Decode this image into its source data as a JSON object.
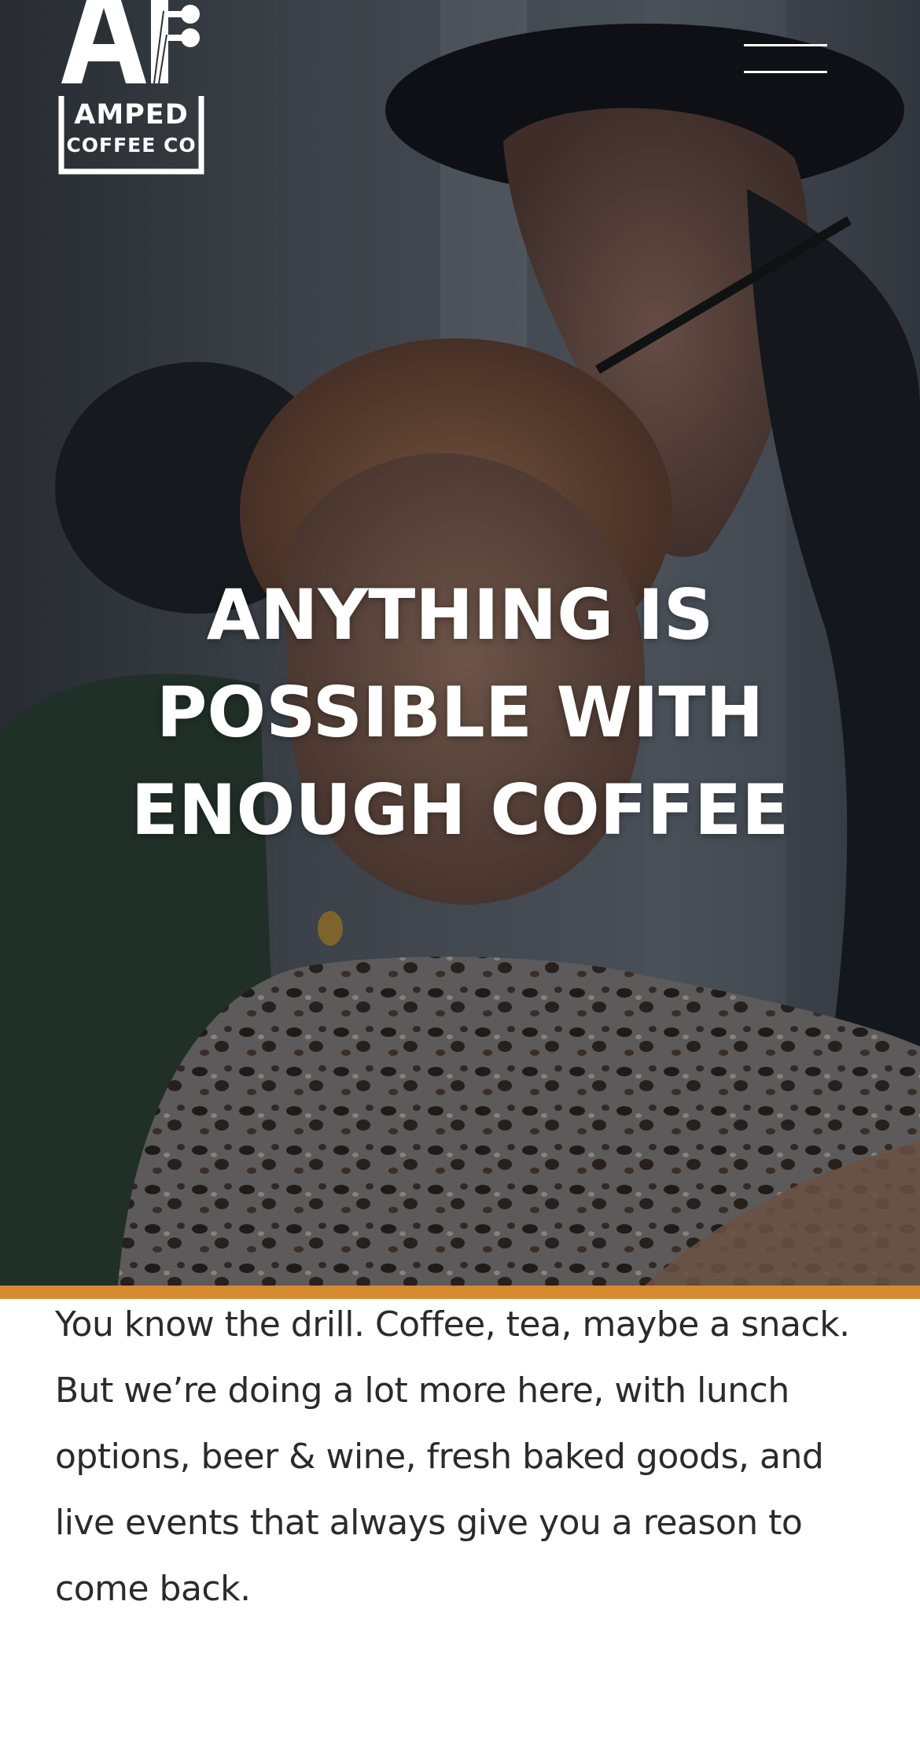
{
  "brand": {
    "logo_word1": "AMPED",
    "logo_word2": "COFFEE CO"
  },
  "nav": {
    "menu_icon": "hamburger-menu-icon"
  },
  "hero": {
    "headline": "ANYTHING IS POSSIBLE WITH ENOUGH COFFEE"
  },
  "intro": {
    "text": "You know the drill. Coffee, tea, maybe a snack. But we’re doing a lot more here, with lunch options, beer & wine, fresh baked goods, and live events that always give you a reason to come back."
  },
  "colors": {
    "accent": "#d68a30",
    "text": "#2b2b2b",
    "headline": "#ffffff"
  }
}
